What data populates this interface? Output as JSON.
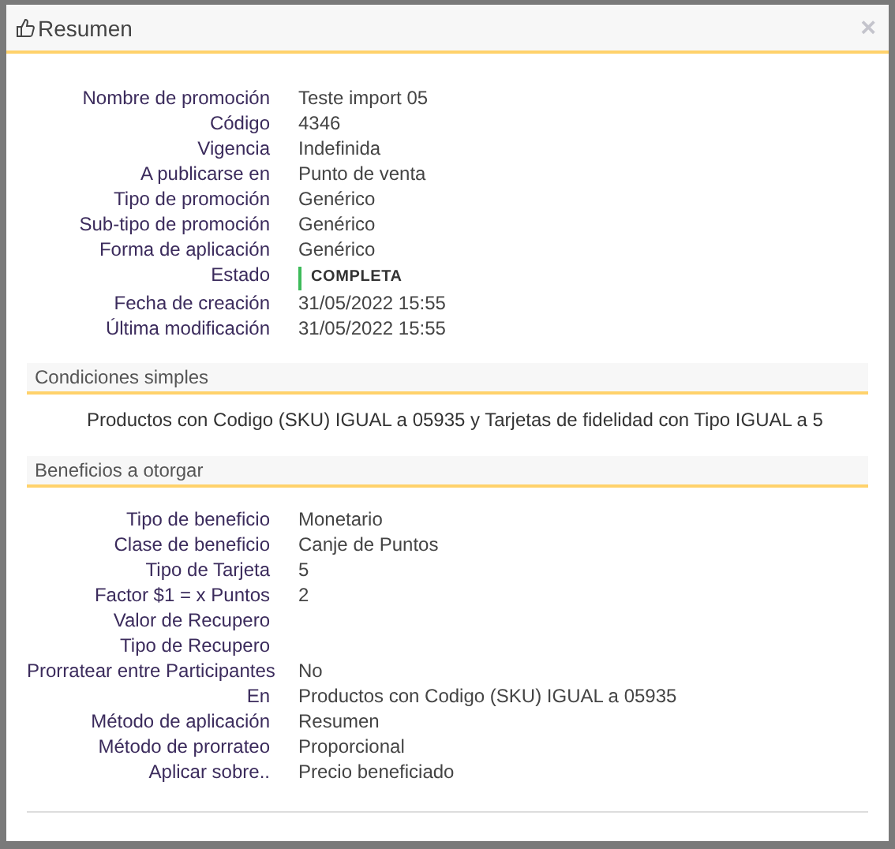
{
  "dialog": {
    "title": "Resumen",
    "close": "×"
  },
  "summary": [
    {
      "label": "Nombre de promoción",
      "value": "Teste import 05"
    },
    {
      "label": "Código",
      "value": "4346"
    },
    {
      "label": "Vigencia",
      "value": "Indefinida"
    },
    {
      "label": "A publicarse en",
      "value": "Punto de venta"
    },
    {
      "label": "Tipo de promoción",
      "value": "Genérico"
    },
    {
      "label": "Sub-tipo de promoción",
      "value": "Genérico"
    },
    {
      "label": "Forma de aplicación",
      "value": "Genérico"
    },
    {
      "label": "Estado",
      "value": "COMPLETA",
      "kind": "status"
    },
    {
      "label": "Fecha de creación",
      "value": "31/05/2022 15:55"
    },
    {
      "label": "Última modificación",
      "value": "31/05/2022 15:55"
    }
  ],
  "conditions": {
    "title": "Condiciones simples",
    "text": "Productos con Codigo (SKU) IGUAL a 05935 y Tarjetas de fidelidad con Tipo IGUAL a 5"
  },
  "benefits": {
    "title": "Beneficios a otorgar",
    "rows": [
      {
        "label": "Tipo de beneficio",
        "value": "Monetario"
      },
      {
        "label": "Clase de beneficio",
        "value": "Canje de Puntos"
      },
      {
        "label": "Tipo de Tarjeta",
        "value": "5"
      },
      {
        "label": "Factor $1 = x Puntos",
        "value": "2"
      },
      {
        "label": "Valor de Recupero"
      },
      {
        "label": "Tipo de Recupero"
      },
      {
        "label": "Prorratear entre Participantes",
        "value": "No"
      },
      {
        "label": "En",
        "value": "Productos con Codigo (SKU) IGUAL a 05935"
      },
      {
        "label": "Método de aplicación",
        "value": "Resumen"
      },
      {
        "label": "Método de prorrateo",
        "value": "Proporcional"
      },
      {
        "label": "Aplicar sobre..",
        "value": "Precio beneficiado"
      }
    ]
  }
}
